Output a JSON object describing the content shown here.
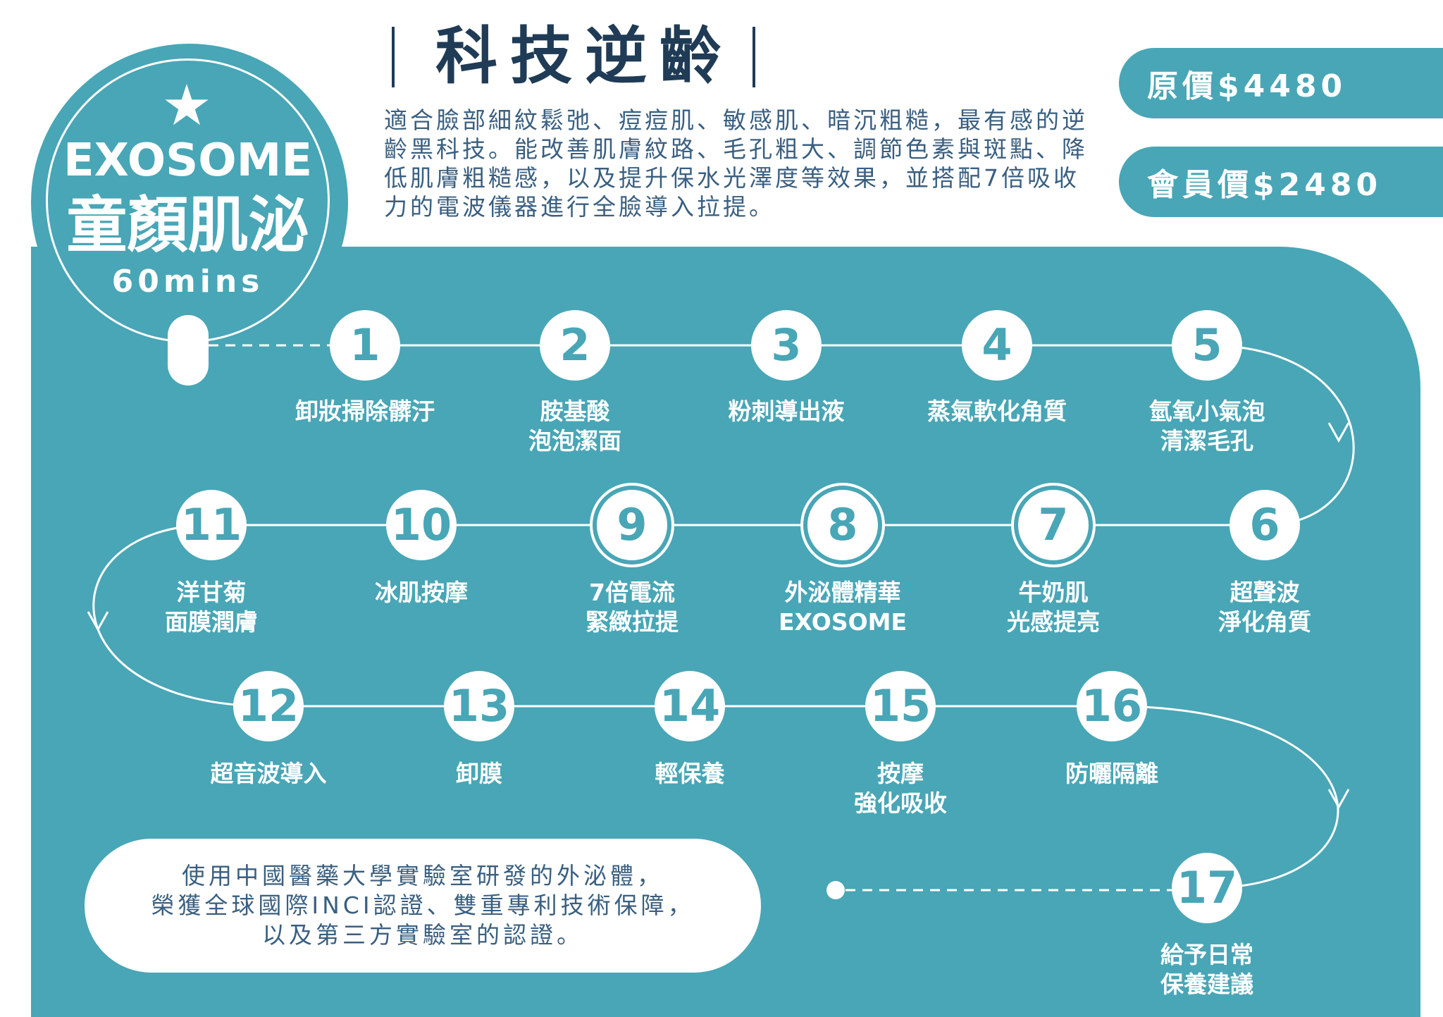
{
  "badge": {
    "star": "★",
    "en": "EXOSOME",
    "zh": "童顏肌泌",
    "duration": "60mins"
  },
  "header": {
    "title": "科技逆齡",
    "description": "適合臉部細紋鬆弛、痘痘肌、敏感肌、暗沉粗糙，最有感的逆齡黑科技。能改善肌膚紋路、毛孔粗大、調節色素與斑點、降低肌膚粗糙感，以及提升保水光澤度等效果，並搭配7倍吸收力的電波儀器進行全臉導入拉提。"
  },
  "prices": {
    "original": "原價$4480",
    "member": "會員價$2480"
  },
  "steps": [
    {
      "num": "1",
      "label": "卸妝掃除髒汙"
    },
    {
      "num": "2",
      "label": "胺基酸\n泡泡潔面"
    },
    {
      "num": "3",
      "label": "粉刺導出液"
    },
    {
      "num": "4",
      "label": "蒸氣軟化角質"
    },
    {
      "num": "5",
      "label": "氫氧小氣泡\n清潔毛孔"
    },
    {
      "num": "6",
      "label": "超聲波\n淨化角質"
    },
    {
      "num": "7",
      "label": "牛奶肌\n光感提亮"
    },
    {
      "num": "8",
      "label": "外泌體精華\nEXOSOME"
    },
    {
      "num": "9",
      "label": "7倍電流\n緊緻拉提"
    },
    {
      "num": "10",
      "label": "冰肌按摩"
    },
    {
      "num": "11",
      "label": "洋甘菊\n面膜潤膚"
    },
    {
      "num": "12",
      "label": "超音波導入"
    },
    {
      "num": "13",
      "label": "卸膜"
    },
    {
      "num": "14",
      "label": "輕保養"
    },
    {
      "num": "15",
      "label": "按摩\n強化吸收"
    },
    {
      "num": "16",
      "label": "防曬隔離"
    },
    {
      "num": "17",
      "label": "給予日常\n保養建議"
    }
  ],
  "footer": {
    "text": "使用中國醫藥大學實驗室研發的外泌體，\n榮獲全球國際INCI認證、雙重專利技術保障，\n以及第三方實驗室的認證。"
  },
  "colors": {
    "teal": "#48a6b6",
    "navy": "#1f3b56",
    "text_blue": "#3a5f80",
    "white": "#ffffff"
  }
}
